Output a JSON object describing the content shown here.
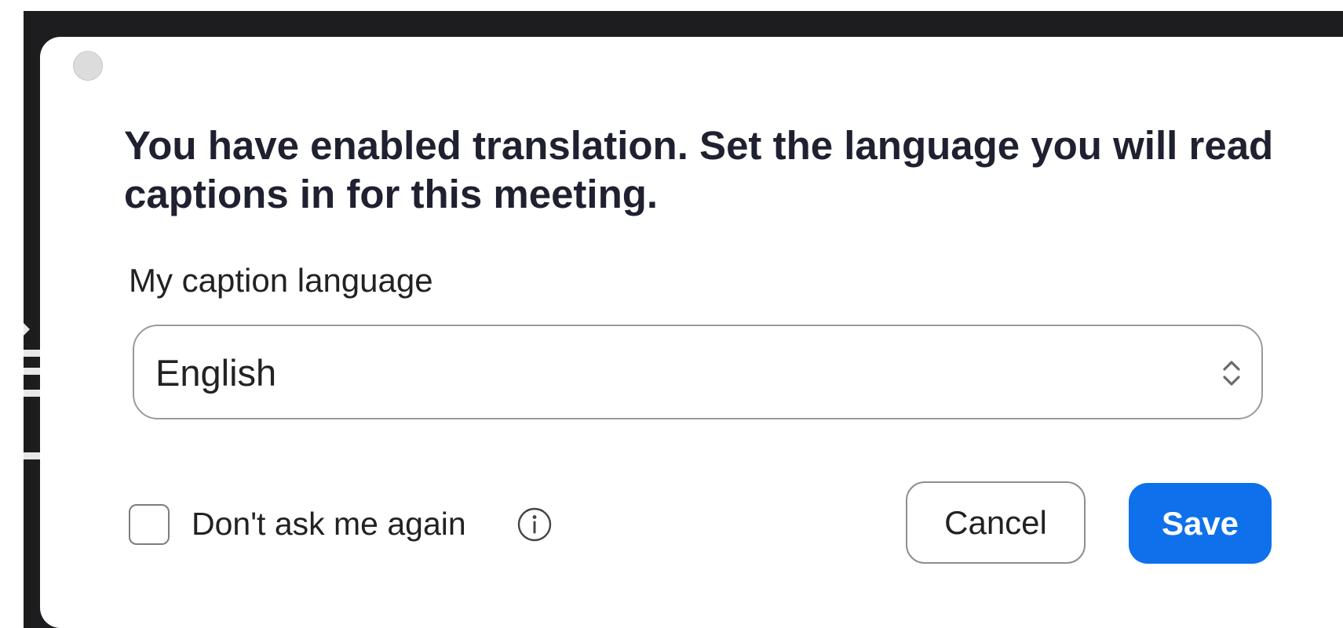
{
  "dialog": {
    "message": "You have enabled translation. Set the language you will read captions in for this meeting.",
    "caption_language": {
      "label": "My caption language",
      "selected_value": "English"
    },
    "dont_ask_again": {
      "label": "Don't ask me again",
      "checked": false
    },
    "buttons": {
      "cancel_label": "Cancel",
      "save_label": "Save"
    }
  },
  "colors": {
    "accent": "#0e71eb",
    "backdrop": "#1d1d1f",
    "text": "#1f2130"
  },
  "icons": {
    "window_control": "close-dot-icon",
    "select_indicator": "chevron-up-down-icon",
    "help": "info-icon"
  }
}
